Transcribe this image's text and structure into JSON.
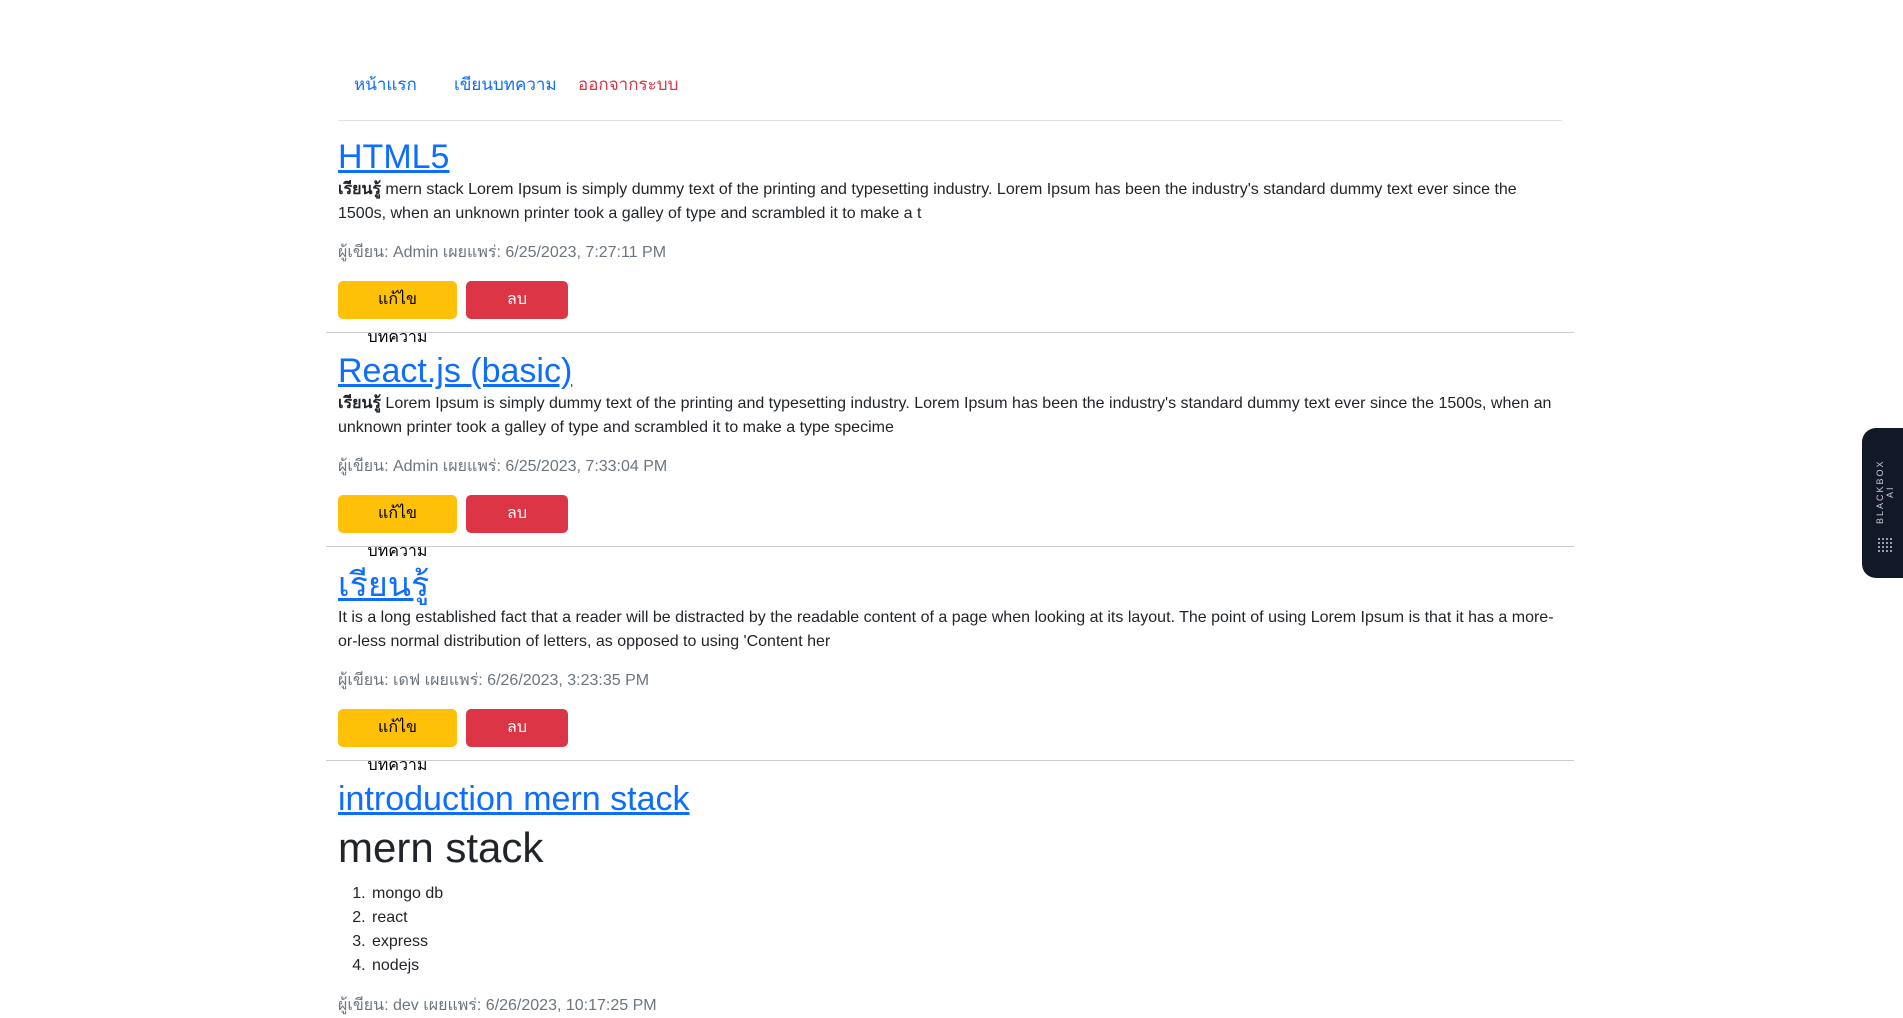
{
  "nav": {
    "home": "หน้าแรก",
    "write": "เขียนบทความ",
    "logout": "ออกจากระบบ"
  },
  "buttons": {
    "edit": "แก้ไขบทความ",
    "delete": "ลบบทความ"
  },
  "posts": [
    {
      "title": "HTML5",
      "excerpt_bold": "เรียนรู้",
      "excerpt": " mern stack Lorem Ipsum is simply dummy text of the printing and typesetting industry. Lorem Ipsum has been the industry's standard dummy text ever since the 1500s, when an unknown printer took a galley of type and scrambled it to make a t",
      "meta": "ผู้เขียน: Admin เผยแพร่: 6/25/2023, 7:27:11 PM"
    },
    {
      "title": "React.js (basic)",
      "excerpt_bold": "เรียนรู้",
      "excerpt": " Lorem Ipsum is simply dummy text of the printing and typesetting industry. Lorem Ipsum has been the industry's standard dummy text ever since the 1500s, when an unknown printer took a galley of type and scrambled it to make a type specime",
      "meta": "ผู้เขียน: Admin เผยแพร่: 6/25/2023, 7:33:04 PM"
    },
    {
      "title": "เรียนรู้",
      "excerpt_bold": "",
      "excerpt": "It is a long established fact that a reader will be distracted by the readable content of a page when looking at its layout. The point of using Lorem Ipsum is that it has a more-or-less normal distribution of letters, as opposed to using 'Content her",
      "meta": "ผู้เขียน: เดฟ เผยแพร่: 6/26/2023, 3:23:35 PM"
    },
    {
      "title": "introduction mern stack",
      "heading": "mern stack",
      "list": [
        "mongo db",
        "react",
        "express",
        "nodejs"
      ],
      "meta": "ผู้เขียน: dev เผยแพร่: 6/26/2023, 10:17:25 PM"
    }
  ],
  "widget": {
    "label": "BLACKBOX AI",
    "icon": "blackbox-logo-icon",
    "color": "#111827"
  }
}
